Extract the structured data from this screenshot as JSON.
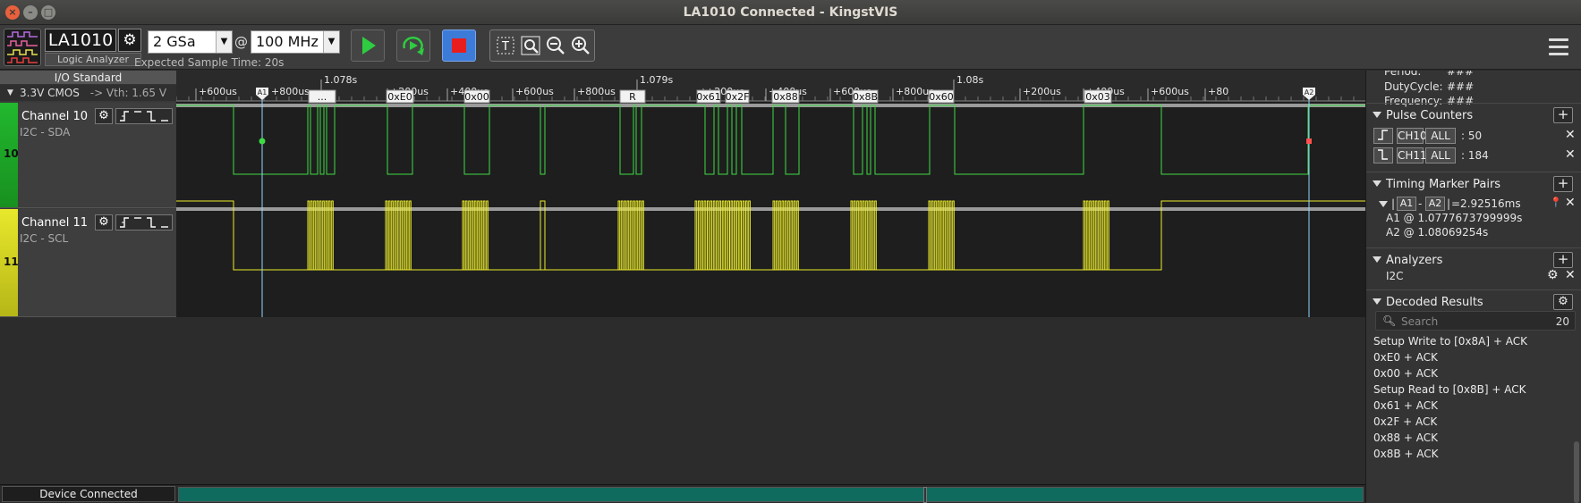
{
  "window": {
    "title": "LA1010 Connected - KingstVIS"
  },
  "toolbar": {
    "device_name": "LA1010",
    "device_subtitle": "Logic Analyzer",
    "sample_depth": "2 GSa",
    "at_sign": "@",
    "sample_rate": "100 MHz",
    "expected_time": "Expected Sample Time: 20s",
    "icons": [
      "logic-analyzer-icon",
      "gear-icon",
      "play-icon",
      "loop-play-icon",
      "stop-icon",
      "text-tool-icon",
      "zoom-fit-icon",
      "zoom-out-icon",
      "zoom-in-icon",
      "hamburger-menu-icon"
    ],
    "colors": {
      "play": "#2ecc40",
      "stop": "#e81e1e",
      "stop_bg": "#3d7bd8"
    }
  },
  "io": {
    "standard_label": "I/O Standard",
    "level": "3.3V CMOS",
    "vth": "-> Vth: 1.65 V"
  },
  "channels": [
    {
      "num": "10",
      "name": "Channel 10",
      "sub": "I2C - SDA",
      "color": "#3ddc44",
      "bar": "#22b82e"
    },
    {
      "num": "11",
      "name": "Channel 11",
      "sub": "I2C - SCL",
      "color": "#ecec2a",
      "bar": "#d8d820"
    }
  ],
  "timeline": {
    "ticks": [
      "+600us",
      "1.078s",
      "+200us",
      "+400us",
      "+600us",
      "+800us",
      "1.079s",
      "+200us",
      "+400us",
      "+600us",
      "+800us",
      "1.08s",
      "+200us",
      "+400us",
      "+600us",
      "+80"
    ],
    "marker_a1": "A1",
    "marker_a2": "A2",
    "marker_tick_a1": "+800us"
  },
  "decode_labels": [
    "...",
    "0xE0",
    "0x00",
    "R",
    "0x61",
    "0x2F",
    "0x88",
    "0x8B",
    "0x60",
    "0x03"
  ],
  "status": {
    "device": "Device Connected"
  },
  "right": {
    "top_lines": [
      "Period:",
      "DutyCycle:",
      "Frequency:"
    ],
    "top_values": [
      "###",
      "###",
      "###"
    ],
    "pulse_title": "Pulse Counters",
    "pulse": [
      {
        "edge": "rising-edge-icon",
        "ch": "CH10",
        "mode": "ALL",
        "count": ": 50"
      },
      {
        "edge": "falling-edge-icon",
        "ch": "CH11",
        "mode": "ALL",
        "count": ": 184"
      }
    ],
    "tm_title": "Timing Marker Pairs",
    "tm_pair": {
      "a": "A1",
      "b": "A2",
      "delta": "=2.92516ms",
      "a1": "A1 @ 1.0777673799999s",
      "a2": "A2 @ 1.08069254s"
    },
    "an_title": "Analyzers",
    "analyzer": "I2C",
    "dr_title": "Decoded Results",
    "search_placeholder": "Search",
    "search_count": "20",
    "results": [
      "Setup Write to [0x8A] + ACK",
      "0xE0 + ACK",
      "0x00 + ACK",
      "Setup Read to [0x8B] + ACK",
      "0x61 + ACK",
      "0x2F + ACK",
      "0x88 + ACK",
      "0x8B + ACK"
    ]
  }
}
